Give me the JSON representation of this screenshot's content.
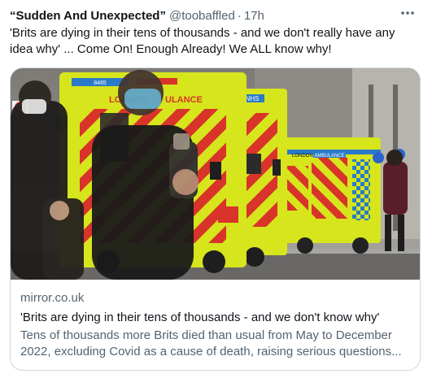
{
  "tweet": {
    "author_name": "“Sudden And Unexpected”",
    "handle": "@toobaffled",
    "separator": "·",
    "time": "17h",
    "more_icon": "more-horizontal-icon",
    "text": "'Brits are dying in their tens of thousands - and we don't really have any idea why' ... Come On! Enough Already! We ALL know why!"
  },
  "card": {
    "image_alt": "Pedestrians in face masks walking past a row of London ambulances",
    "image_text": {
      "plate_number": "8485",
      "london": "LONDON",
      "ambulance_front": "ULANCE",
      "nhs": "NHS",
      "london_back": "LONDON",
      "ambulance_back": "AMBULANCE"
    },
    "domain": "mirror.co.uk",
    "title": "'Brits are dying in their tens of thousands - and we don't know why'",
    "description": "Tens of thousands more Brits died than usual from May to December 2022, excluding Covid as a cause of death, raising serious questions..."
  },
  "colors": {
    "text_primary": "#0f1419",
    "text_secondary": "#536471",
    "border": "#cfd9de",
    "ambulance_yellow": "#d6e51c",
    "ambulance_red": "#d8342a"
  }
}
